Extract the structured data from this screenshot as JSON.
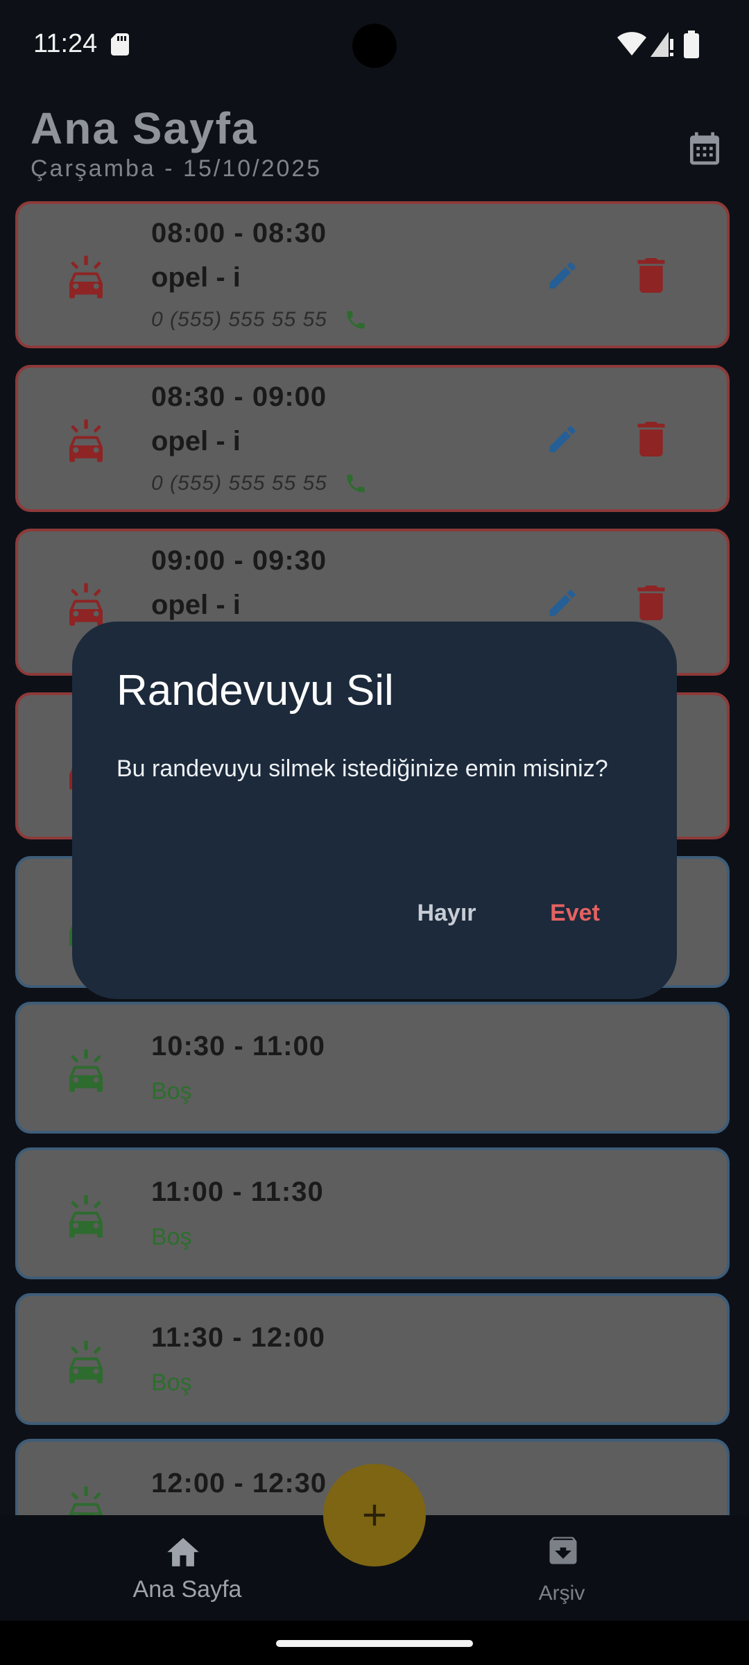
{
  "status_bar": {
    "time": "11:24"
  },
  "header": {
    "title": "Ana Sayfa",
    "date": "Çarşamba - 15/10/2025",
    "calendar_icon": "calendar-icon"
  },
  "slots": [
    {
      "time": "08:00 - 08:30",
      "name": "opel - i",
      "phone": "0 (555) 555 55 55",
      "status": "booked"
    },
    {
      "time": "08:30 - 09:00",
      "name": "opel - i",
      "phone": "0 (555) 555 55 55",
      "status": "booked"
    },
    {
      "time": "09:00 - 09:30",
      "name": "opel - i",
      "status": "booked"
    },
    {
      "status": "booked"
    },
    {
      "status": "empty"
    },
    {
      "time": "10:30 - 11:00",
      "label": "Boş",
      "status": "empty"
    },
    {
      "time": "11:00 - 11:30",
      "label": "Boş",
      "status": "empty"
    },
    {
      "time": "11:30 - 12:00",
      "label": "Boş",
      "status": "empty"
    },
    {
      "time": "12:00 - 12:30",
      "status": "empty"
    }
  ],
  "dialog": {
    "title": "Randevuyu Sil",
    "message": "Bu randevuyu silmek istediğinize emin misiniz?",
    "no_label": "Hayır",
    "yes_label": "Evet"
  },
  "bottom_nav": {
    "home_label": "Ana Sayfa",
    "archive_label": "Arşiv"
  },
  "colors": {
    "booked_icon": "#8e2424",
    "empty_icon": "#2e6b2e",
    "edit_icon": "#255f96",
    "delete_icon": "#8e2424",
    "phone_icon": "#2e6b2e",
    "dialog_bg": "#1c2a3b",
    "yes_text": "#e46262",
    "fab": "#7d6513"
  }
}
